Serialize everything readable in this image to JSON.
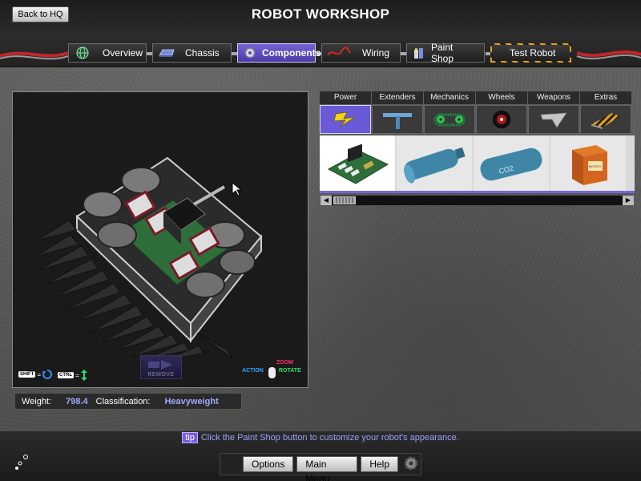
{
  "header": {
    "title": "ROBOT WORKSHOP",
    "back_label": "Back to HQ"
  },
  "tabs": [
    {
      "label": "Overview",
      "icon": "globe-icon"
    },
    {
      "label": "Chassis",
      "icon": "chassis-icon"
    },
    {
      "label": "Components",
      "icon": "gear-icon",
      "active": true
    },
    {
      "label": "Wiring",
      "icon": "wire-icon"
    },
    {
      "label": "Paint Shop",
      "icon": "paint-icon"
    },
    {
      "label": "Test Robot",
      "icon": "none"
    }
  ],
  "viewport": {
    "remove_label": "REMOVE",
    "shift_key": "SHIFT",
    "ctrl_key": "CTRL",
    "equals": "=",
    "zoom_label": "ZOOM",
    "action_label": "ACTION",
    "rotate_label": "ROTATE"
  },
  "stats": {
    "weight_label": "Weight:",
    "weight_value": "798.4",
    "class_label": "Classification:",
    "class_value": "Heavyweight"
  },
  "components": {
    "categories": [
      {
        "label": "Power",
        "icon": "lightning-icon",
        "active": true
      },
      {
        "label": "Extenders",
        "icon": "t-bar-icon"
      },
      {
        "label": "Mechanics",
        "icon": "chain-drive-icon"
      },
      {
        "label": "Wheels",
        "icon": "wheel-icon"
      },
      {
        "label": "Weapons",
        "icon": "blade-icon"
      },
      {
        "label": "Extras",
        "icon": "striped-wedge-icon"
      }
    ],
    "items": [
      {
        "name": "circuit-board-icon",
        "selected": true
      },
      {
        "name": "blue-cylinder-tank-icon",
        "text": ""
      },
      {
        "name": "co2-tank-icon",
        "text": "CO2"
      },
      {
        "name": "battery-box-icon",
        "text": "BATTERY"
      }
    ],
    "scroll_left": "◀",
    "scroll_right": "▶"
  },
  "footer": {
    "tip_tag": "tip",
    "tip_text": "Click the Paint Shop button to customize your robot's appearance.",
    "options_label": "Options",
    "main_menu_label": "Main Menu",
    "help_label": "Help"
  },
  "colors": {
    "accent": "#7565d6",
    "highlight_text": "#9ea8ff",
    "tip_text": "#9aa0ff"
  }
}
